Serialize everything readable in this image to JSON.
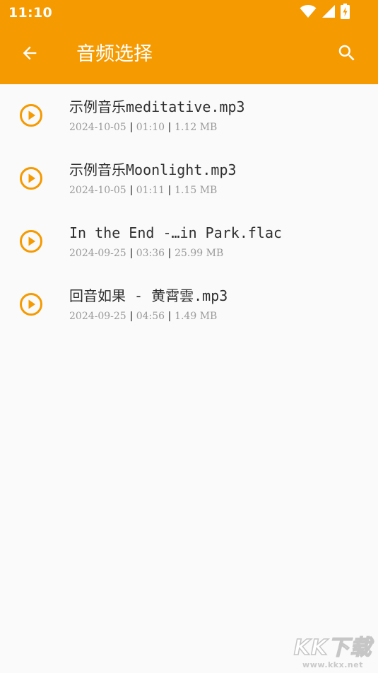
{
  "status_bar": {
    "time": "11:10",
    "icons": [
      "wifi-icon",
      "signal-icon",
      "battery-charging-icon"
    ]
  },
  "app_bar": {
    "title": "音频选择",
    "back_icon": "arrow-back-icon",
    "search_icon": "search-icon"
  },
  "colors": {
    "accent": "#f59a00",
    "background": "#fafafa",
    "title_text": "#2f2f2f",
    "meta_text": "#9a9a9a"
  },
  "audio_files": [
    {
      "name": "示例音乐meditative.mp3",
      "date": "2024-10-05",
      "duration": "01:10",
      "size": "1.12 MB"
    },
    {
      "name": "示例音乐Moonlight.mp3",
      "date": "2024-10-05",
      "duration": "01:11",
      "size": "1.15 MB"
    },
    {
      "name": "In the End -…in Park.flac",
      "date": "2024-09-25",
      "duration": "03:36",
      "size": "25.99 MB"
    },
    {
      "name": "回音如果 - 黄霄雲.mp3",
      "date": "2024-09-25",
      "duration": "04:56",
      "size": "1.49 MB"
    }
  ],
  "watermark": {
    "logo": "KK下载",
    "url": "www.kkx.net"
  }
}
